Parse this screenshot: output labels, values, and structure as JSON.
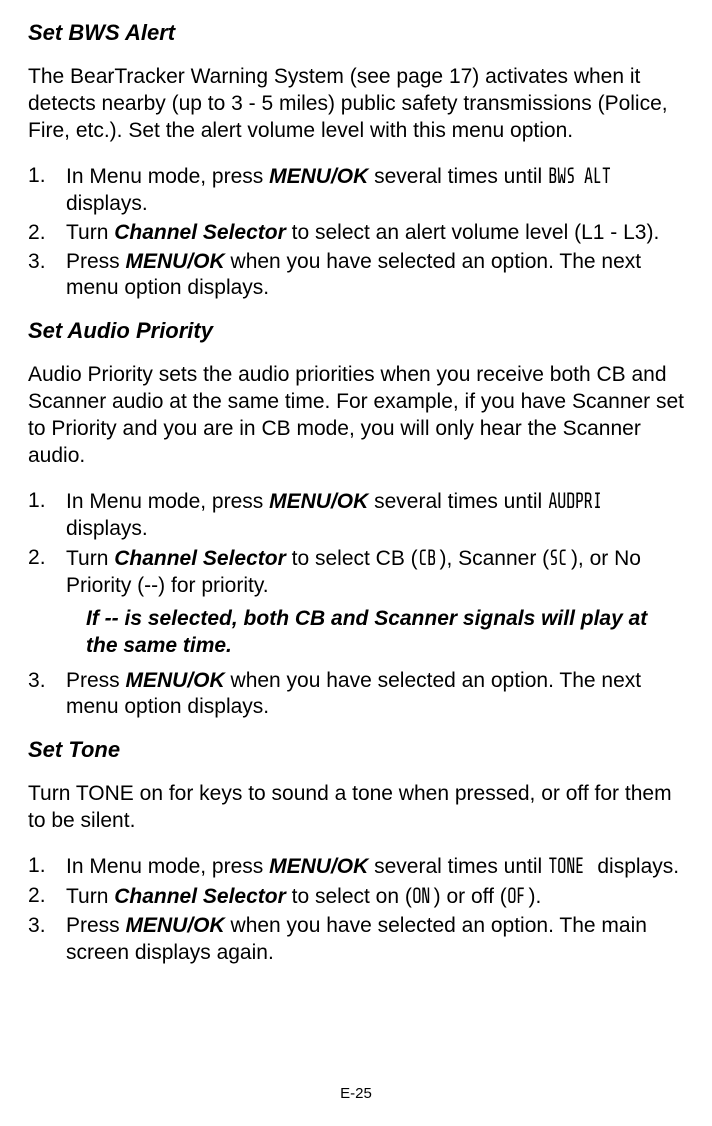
{
  "sections": {
    "bws": {
      "title": "Set BWS Alert",
      "intro": "The BearTracker Warning System (see page 17) activates when it detects nearby (up to 3 - 5 miles) public safety transmissions (Police, Fire, etc.). Set the alert volume level with this menu option.",
      "steps": {
        "one_a": "In Menu mode, press ",
        "one_bold": "MENU/OK",
        "one_b": " several times until ",
        "one_lcd": "BWS ALT",
        "one_c": " displays.",
        "two_a": "Turn ",
        "two_bold": "Channel Selector",
        "two_b": " to select an alert volume level (L1 - L3).",
        "three_a": "Press ",
        "three_bold": "MENU/OK",
        "three_b": " when you have selected an option. The next menu option displays."
      }
    },
    "audio": {
      "title": "Set Audio Priority",
      "intro": "Audio Priority sets the audio priorities when you receive both CB and Scanner audio at the same time. For example, if you have Scanner set to Priority and you are in CB mode, you will only hear the Scanner audio.",
      "steps": {
        "one_a": "In Menu mode, press ",
        "one_bold": "MENU/OK",
        "one_b": " several times until ",
        "one_lcd": "AUDPRI",
        "one_c": " displays.",
        "two_a": "Turn ",
        "two_bold": "Channel Selector",
        "two_b": " to select CB (",
        "two_lcd1": "CB",
        "two_c": "), Scanner (",
        "two_lcd2": "SC",
        "two_d": "), or No Priority (--) for priority.",
        "three_a": "Press ",
        "three_bold": "MENU/OK",
        "three_b": " when you have selected an option. The next menu option displays."
      },
      "note": "If -- is selected, both CB and Scanner signals will play at the same time."
    },
    "tone": {
      "title": "Set Tone",
      "intro": "Turn TONE on for keys to sound a tone when pressed, or off for them to be silent.",
      "steps": {
        "one_a": "In Menu mode, press ",
        "one_bold": "MENU/OK",
        "one_b": " several times until ",
        "one_lcd": "TONE",
        "one_c": " displays.",
        "two_a": "Turn ",
        "two_bold": "Channel Selector",
        "two_b": " to select on (",
        "two_lcd1": "ON",
        "two_c": ") or off (",
        "two_lcd2": "OF",
        "two_d": ").",
        "three_a": "Press ",
        "three_bold": "MENU/OK",
        "three_b": " when you have selected an option. The main screen displays again."
      }
    }
  },
  "pagenum": "E-25"
}
